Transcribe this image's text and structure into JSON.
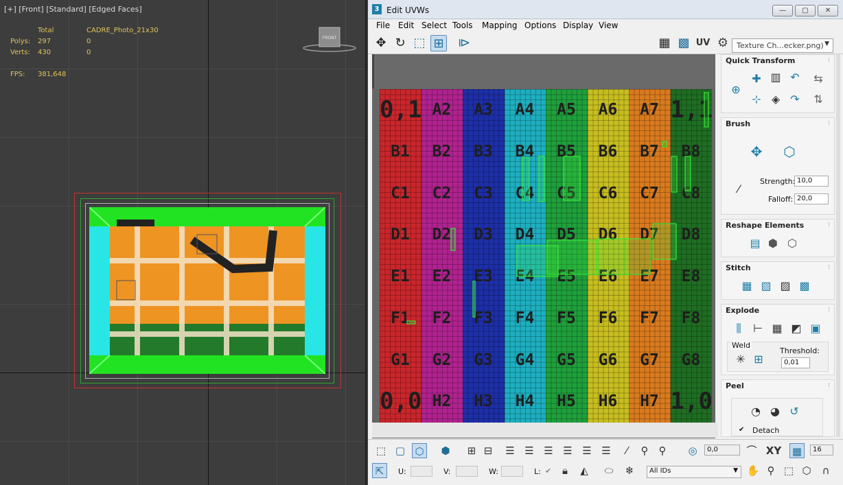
{
  "viewport": {
    "label": "[+] [Front] [Standard] [Edged Faces]",
    "stats": {
      "total_label": "Total",
      "object_name": "CADRE_Photo_21x30",
      "polys_label": "Polys:",
      "polys_total": "297",
      "polys_sel": "0",
      "verts_label": "Verts:",
      "verts_total": "430",
      "verts_sel": "0",
      "fps_label": "FPS:",
      "fps_value": "381,648"
    },
    "viewcube_label": "FRONT"
  },
  "uvw": {
    "title": "Edit UVWs",
    "title_icon": "3",
    "window_buttons": [
      "—",
      "▢",
      "✕"
    ],
    "menus": [
      "File",
      "Edit",
      "Select",
      "Tools",
      "Mapping",
      "Options",
      "Display",
      "View"
    ],
    "uv_label": "UV",
    "texture_dropdown": "Texture Ch...ecker.png)",
    "checker": {
      "rows": [
        "A",
        "B",
        "C",
        "D",
        "E",
        "F",
        "G",
        "H"
      ],
      "corner_top_left": "0,1",
      "corner_top_right": "1,1",
      "corner_bottom_left": "0,0",
      "corner_bottom_right": "1,0",
      "column_colors": [
        "#c9262b",
        "#b0228f",
        "#1d2fa6",
        "#1eaec0",
        "#1f9f3b",
        "#c7bd20",
        "#d87a1e",
        "#1f6d23"
      ]
    },
    "rollouts": {
      "quick_transform": "Quick Transform",
      "brush": "Brush",
      "strength_label": "Strength:",
      "strength_value": "10,0",
      "falloff_label": "Falloff:",
      "falloff_value": "20,0",
      "reshape": "Reshape Elements",
      "stitch": "Stitch",
      "explode": "Explode",
      "weld_label": "Weld",
      "threshold_label": "Threshold:",
      "threshold_value": "0,01",
      "peel": "Peel",
      "detach_label": "Detach",
      "detach_checked": true
    },
    "bottom": {
      "spin_value": "0,0",
      "xy_label": "XY",
      "grid_value": "16",
      "u_label": "U:",
      "v_label": "V:",
      "w_label": "W:",
      "l_label": "L:",
      "ids_dropdown": "All IDs"
    }
  }
}
